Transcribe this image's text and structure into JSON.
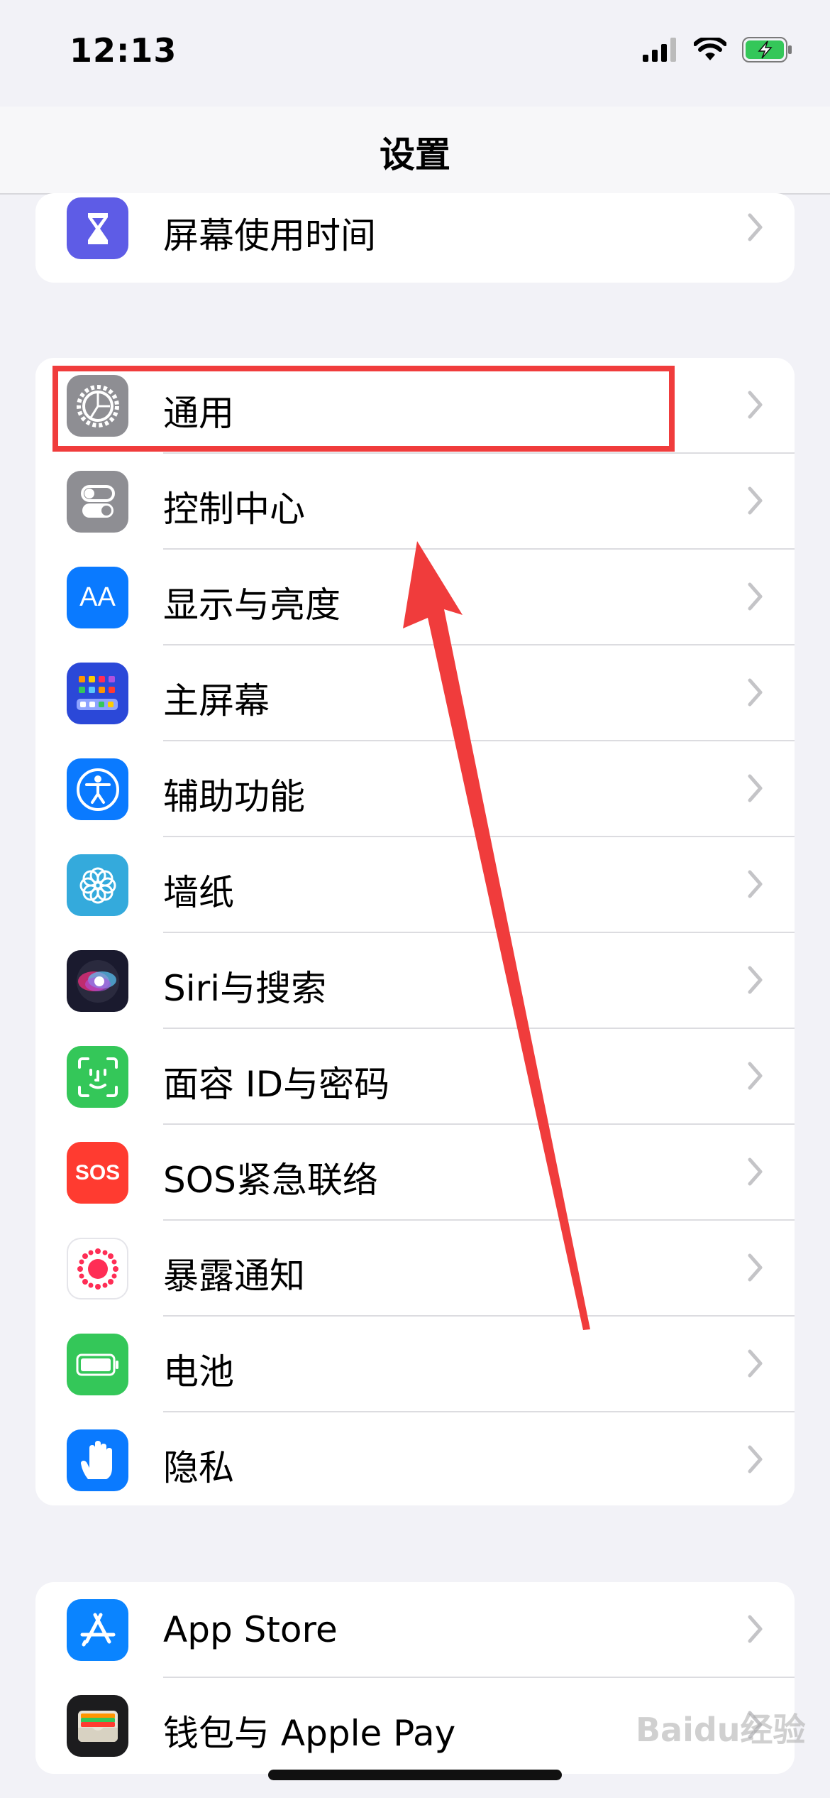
{
  "status": {
    "time": "12:13"
  },
  "nav": {
    "title": "设置"
  },
  "group1": [
    {
      "label": "屏幕使用时间",
      "icon": "hourglass-icon",
      "color": "#5e5ce6"
    }
  ],
  "group2": [
    {
      "label": "通用",
      "icon": "gear-icon",
      "color": "#8e8e93"
    },
    {
      "label": "控制中心",
      "icon": "toggle-switches-icon",
      "color": "#8e8e93"
    },
    {
      "label": "显示与亮度",
      "icon": "text-size-icon",
      "color": "#0a7aff",
      "glyph": "AA"
    },
    {
      "label": "主屏幕",
      "icon": "home-screen-grid-icon",
      "color": "#2b48d8"
    },
    {
      "label": "辅助功能",
      "icon": "accessibility-icon",
      "color": "#0a7aff"
    },
    {
      "label": "墙纸",
      "icon": "flower-icon",
      "color": "#34aadc"
    },
    {
      "label": "Siri与搜索",
      "icon": "siri-orb-icon",
      "color": "#1a1a2e"
    },
    {
      "label": "面容 ID与密码",
      "icon": "face-id-icon",
      "color": "#34c759"
    },
    {
      "label": "SOS紧急联络",
      "icon": "sos-icon",
      "color": "#ff3b30",
      "glyph": "SOS"
    },
    {
      "label": "暴露通知",
      "icon": "exposure-notification-icon",
      "color": "#ffffff"
    },
    {
      "label": "电池",
      "icon": "battery-icon",
      "color": "#34c759"
    },
    {
      "label": "隐私",
      "icon": "hand-icon",
      "color": "#0a7aff"
    }
  ],
  "group3": [
    {
      "label": "App Store",
      "icon": "app-store-icon",
      "color": "#0a84ff"
    },
    {
      "label": "钱包与 Apple Pay",
      "icon": "wallet-icon",
      "color": "#1c1c1e"
    }
  ],
  "watermark": "Baidu经验",
  "accent": {
    "highlight": "#f03c3c",
    "chevron": "#c4c4c7"
  }
}
